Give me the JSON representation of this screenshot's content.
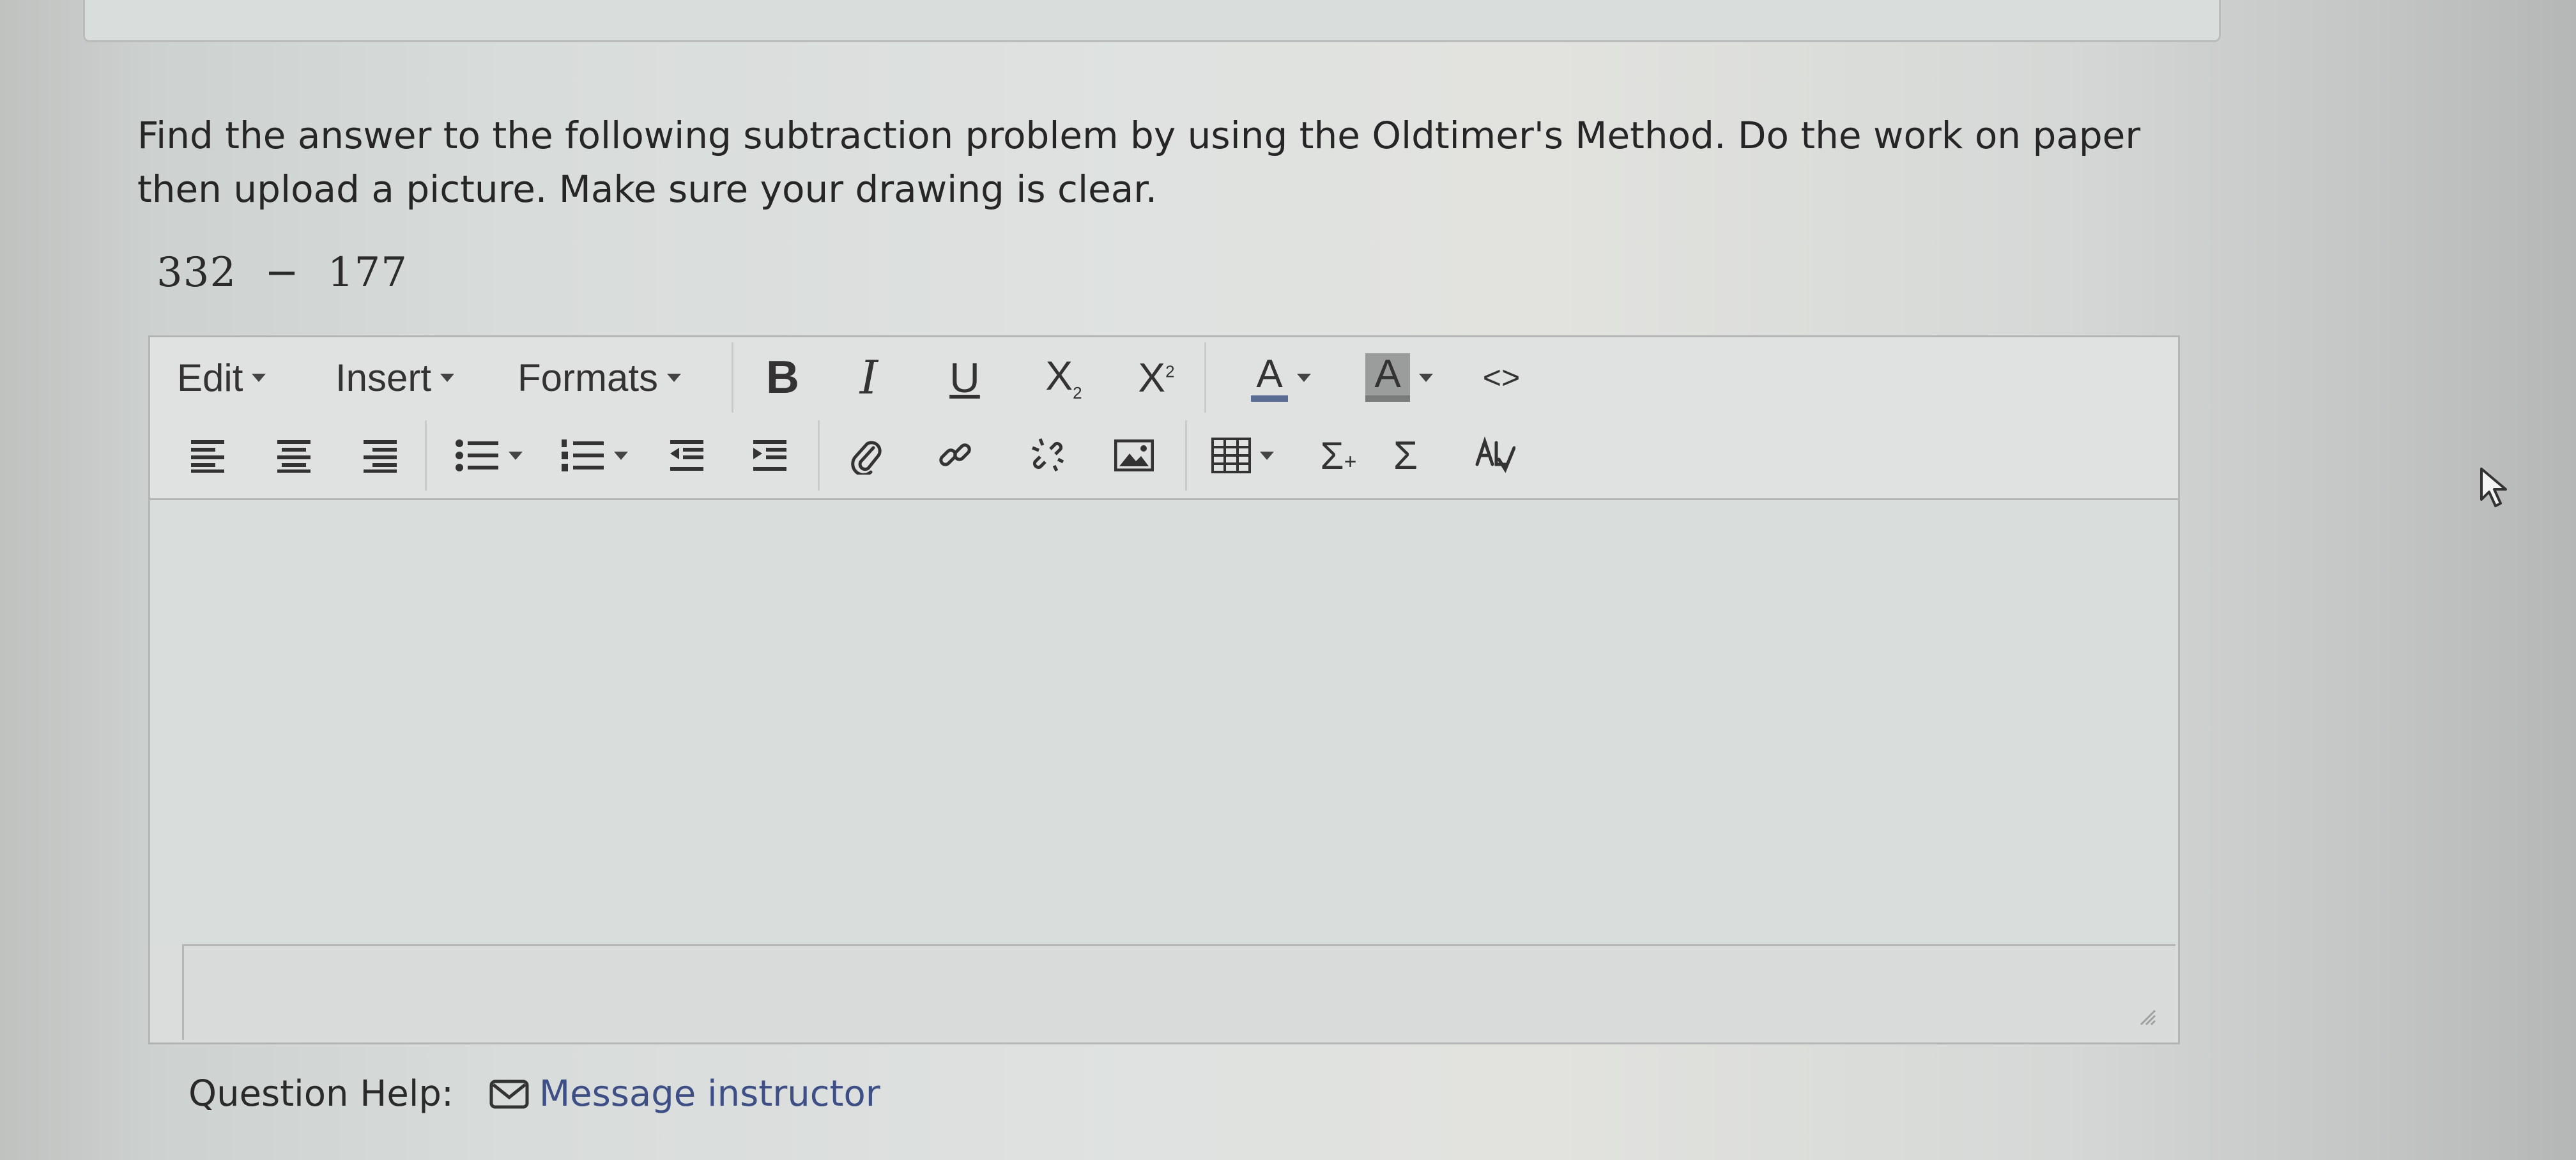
{
  "question": {
    "line1": "Find the answer to the following subtraction problem by using the Oldtimer's Method. Do the work on paper",
    "line2": "then upload a picture. Make sure your drawing is clear."
  },
  "problem": {
    "left": "332",
    "operator": "−",
    "right": "177"
  },
  "editor": {
    "menus": [
      "Edit",
      "Insert",
      "Formats"
    ],
    "format_buttons": {
      "bold": "B",
      "italic": "I",
      "underline": "U",
      "subscript": "X",
      "superscript": "X",
      "text_color": "A",
      "background_color": "A",
      "source_code": "<>"
    },
    "row2_icons": [
      "align-left-icon",
      "align-center-icon",
      "align-right-icon",
      "bullet-list-icon",
      "numbered-list-icon",
      "outdent-icon",
      "indent-icon",
      "attachment-icon",
      "link-icon",
      "unlink-icon",
      "image-icon",
      "table-icon",
      "sigma-plus-icon",
      "sigma-icon",
      "spellcheck-icon"
    ],
    "colors": {
      "text_color_bar": "#5a6e93",
      "background_color_bar": "#8c8c8c"
    }
  },
  "help": {
    "label": "Question Help:",
    "link_label": "Message instructor",
    "link_icon": "envelope-icon"
  }
}
